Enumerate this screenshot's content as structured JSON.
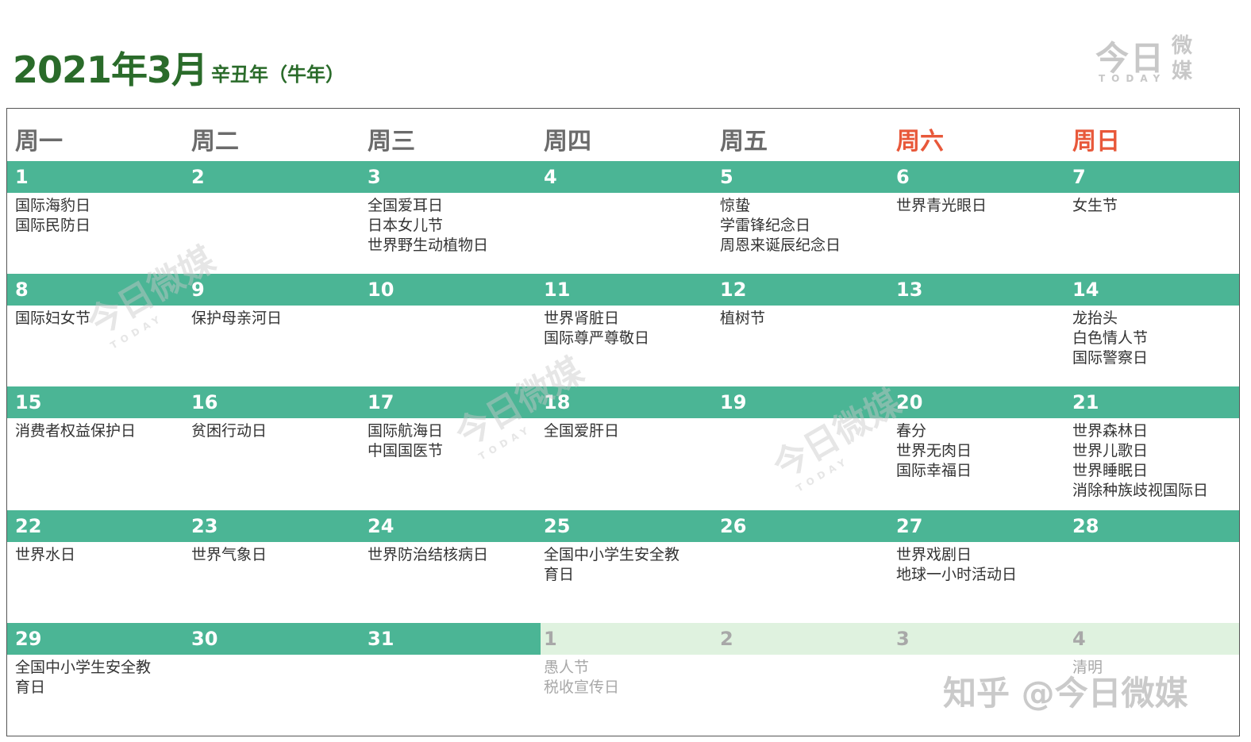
{
  "header": {
    "title": "2021年3月",
    "subtitle": "辛丑年（牛年）"
  },
  "logo": {
    "main": "今日",
    "side_top": "微",
    "side_bottom": "媒",
    "en": "TODAY"
  },
  "weekdays": [
    {
      "label": "周一",
      "weekend": false
    },
    {
      "label": "周二",
      "weekend": false
    },
    {
      "label": "周三",
      "weekend": false
    },
    {
      "label": "周四",
      "weekend": false
    },
    {
      "label": "周五",
      "weekend": false
    },
    {
      "label": "周六",
      "weekend": true
    },
    {
      "label": "周日",
      "weekend": true
    }
  ],
  "weeks": [
    {
      "days": [
        {
          "num": "1",
          "events": [
            "国际海豹日",
            "国际民防日"
          ]
        },
        {
          "num": "2",
          "events": []
        },
        {
          "num": "3",
          "events": [
            "全国爱耳日",
            "日本女儿节",
            "世界野生动植物日"
          ]
        },
        {
          "num": "4",
          "events": []
        },
        {
          "num": "5",
          "events": [
            "惊蛰",
            "学雷锋纪念日",
            "周恩来诞辰纪念日"
          ]
        },
        {
          "num": "6",
          "events": [
            "世界青光眼日"
          ]
        },
        {
          "num": "7",
          "events": [
            "女生节"
          ]
        }
      ]
    },
    {
      "days": [
        {
          "num": "8",
          "events": [
            "国际妇女节"
          ]
        },
        {
          "num": "9",
          "events": [
            "保护母亲河日"
          ]
        },
        {
          "num": "10",
          "events": []
        },
        {
          "num": "11",
          "events": [
            "世界肾脏日",
            "国际尊严尊敬日"
          ]
        },
        {
          "num": "12",
          "events": [
            "植树节"
          ]
        },
        {
          "num": "13",
          "events": []
        },
        {
          "num": "14",
          "events": [
            "龙抬头",
            "白色情人节",
            "国际警察日"
          ]
        }
      ]
    },
    {
      "days": [
        {
          "num": "15",
          "events": [
            "消费者权益保护日"
          ]
        },
        {
          "num": "16",
          "events": [
            "贫困行动日"
          ]
        },
        {
          "num": "17",
          "events": [
            "国际航海日",
            "中国国医节"
          ]
        },
        {
          "num": "18",
          "events": [
            "全国爱肝日"
          ]
        },
        {
          "num": "19",
          "events": []
        },
        {
          "num": "20",
          "events": [
            "春分",
            "世界无肉日",
            "国际幸福日"
          ]
        },
        {
          "num": "21",
          "events": [
            "世界森林日",
            "世界儿歌日",
            "世界睡眠日",
            "消除种族歧视国际日"
          ]
        }
      ]
    },
    {
      "days": [
        {
          "num": "22",
          "events": [
            "世界水日"
          ]
        },
        {
          "num": "23",
          "events": [
            "世界气象日"
          ]
        },
        {
          "num": "24",
          "events": [
            "世界防治结核病日"
          ]
        },
        {
          "num": "25",
          "events": [
            "全国中小学生安全教",
            "育日"
          ]
        },
        {
          "num": "26",
          "events": []
        },
        {
          "num": "27",
          "events": [
            "世界戏剧日",
            "地球一小时活动日"
          ]
        },
        {
          "num": "28",
          "events": []
        }
      ]
    },
    {
      "days": [
        {
          "num": "29",
          "events": [
            "全国中小学生安全教",
            "育日"
          ]
        },
        {
          "num": "30",
          "events": []
        },
        {
          "num": "31",
          "events": []
        },
        {
          "num": "1",
          "events": [
            "愚人节",
            "税收宣传日"
          ],
          "next": true
        },
        {
          "num": "2",
          "events": [],
          "next": true
        },
        {
          "num": "3",
          "events": [],
          "next": true
        },
        {
          "num": "4",
          "events": [
            "清明"
          ],
          "next": true
        }
      ]
    }
  ],
  "watermark": {
    "main": "今日微媒",
    "en": "TODAY"
  },
  "zhihu": "知乎 @今日微媒"
}
